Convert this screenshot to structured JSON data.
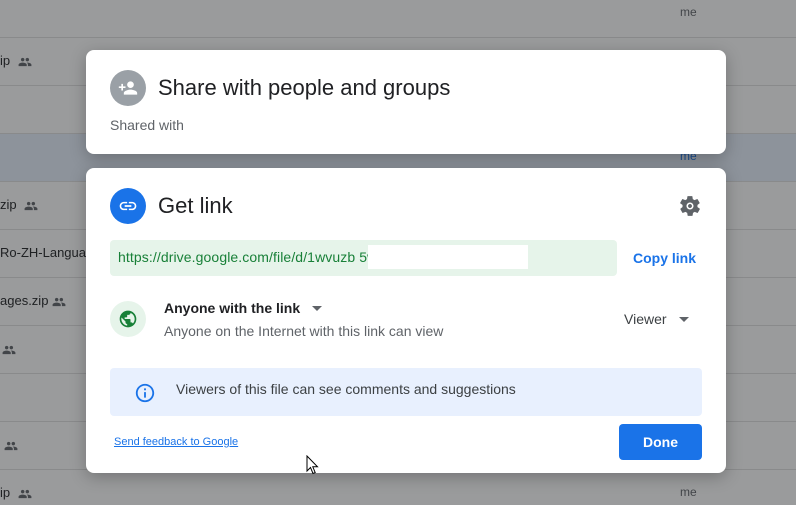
{
  "background_list": {
    "rows": [
      {
        "name": "",
        "owner": "me",
        "shared": false,
        "selected": false
      },
      {
        "name": "ip",
        "owner": "",
        "shared": true,
        "selected": false
      },
      {
        "name": "",
        "owner": "",
        "shared": false,
        "selected": false
      },
      {
        "name": "",
        "owner": "me",
        "shared": false,
        "selected": true
      },
      {
        "name": "zip",
        "owner": "",
        "shared": true,
        "selected": false
      },
      {
        "name": "Ro-ZH-Languag",
        "owner": "",
        "shared": false,
        "selected": false
      },
      {
        "name": "ages.zip",
        "owner": "",
        "shared": true,
        "selected": false
      },
      {
        "name": "",
        "owner": "",
        "shared": true,
        "selected": false
      },
      {
        "name": "",
        "owner": "",
        "shared": false,
        "selected": false
      },
      {
        "name": "",
        "owner": "",
        "shared": true,
        "selected": false
      },
      {
        "name": "ip",
        "owner": "me",
        "shared": true,
        "selected": false
      }
    ]
  },
  "share_card": {
    "title": "Share with people and groups",
    "shared_with_label": "Shared with",
    "icon": "person-add-icon"
  },
  "link_card": {
    "title": "Get link",
    "icon": "link-icon",
    "settings_icon": "gear-icon",
    "url": "https://drive.google.com/file/d/1wvuzb                                   5woG2l17J/...",
    "copy_link_label": "Copy link",
    "access": {
      "label": "Anyone with the link",
      "description": "Anyone on the Internet with this link can view",
      "icon": "globe-icon"
    },
    "role": "Viewer",
    "info": {
      "text": "Viewers of this file can see comments and suggestions",
      "icon": "info-icon"
    },
    "feedback_label": "Send feedback to Google",
    "done_label": "Done"
  },
  "colors": {
    "accent": "#1a73e8",
    "link_green": "#188038",
    "url_bg": "#e6f4ea",
    "info_bg": "#e8f0fe"
  }
}
